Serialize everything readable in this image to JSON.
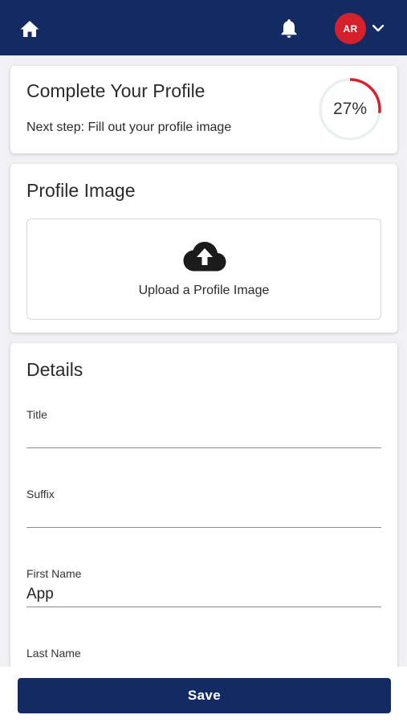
{
  "header": {
    "avatar_initials": "AR",
    "home_icon": "home-icon",
    "bell_icon": "bell-icon",
    "menu_icon": "chevron-down-icon",
    "background_color": "#142a63",
    "avatar_color": "#d5212b"
  },
  "progress": {
    "title": "Complete Your Profile",
    "next_step": "Next step: Fill out your profile image",
    "percent_label": "27%",
    "percent_value": 27,
    "ring_color": "#d5212b",
    "ring_track_color": "#e8f1f0"
  },
  "profile_image": {
    "title": "Profile Image",
    "upload_label": "Upload a Profile Image",
    "upload_icon": "cloud-upload-icon"
  },
  "details": {
    "title": "Details",
    "fields": [
      {
        "label": "Title",
        "value": ""
      },
      {
        "label": "Suffix",
        "value": ""
      },
      {
        "label": "First Name",
        "value": "App"
      },
      {
        "label": "Last Name",
        "value": ""
      }
    ]
  },
  "footer": {
    "save_label": "Save"
  }
}
